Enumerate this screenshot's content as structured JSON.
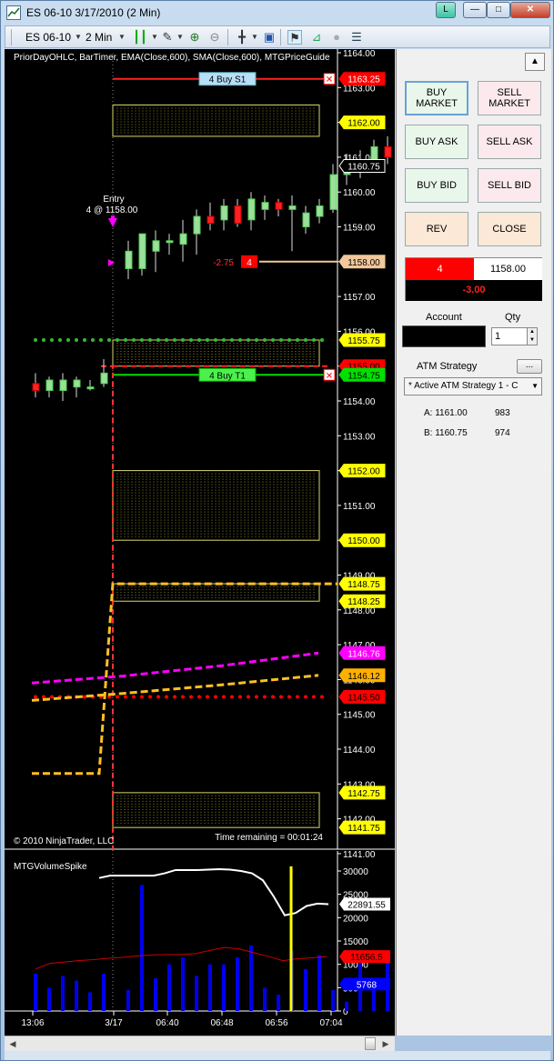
{
  "window": {
    "title": "ES 06-10  3/17/2010 (2 Min)",
    "link_badge": "L",
    "minimize_glyph": "—",
    "maximize_glyph": "□",
    "close_glyph": "✕"
  },
  "toolbar": {
    "instrument": "ES 06-10",
    "interval": "2 Min",
    "icons": [
      "chart-style-icon",
      "draw-tool-icon",
      "zoom-in-icon",
      "zoom-out-icon",
      "crosshair-icon",
      "properties-icon",
      "strategy-icon",
      "indicator-icon",
      "circle-icon",
      "data-box-icon"
    ]
  },
  "chart": {
    "indicators_label": "PriorDayOHLC, BarTimer, EMA(Close,600), SMA(Close,600), MTGPriceGuide",
    "copyright": "© 2010 NinjaTrader, LLC",
    "time_remaining": "Time remaining = 00:01:24",
    "entry_label": "Entry",
    "entry_detail": "4 @ 1158.00",
    "pnl_points": "-2.75",
    "position_qty": "4",
    "buy_s1_label": "4  Buy S1",
    "buy_t1_label": "4  Buy T1",
    "x_labels": [
      "13:06",
      "3/17",
      "06:40",
      "06:48",
      "06:56",
      "07:04"
    ],
    "y_ticks": [
      "1164.00",
      "1163.00",
      "1162.00",
      "1161.00",
      "1160.00",
      "1159.00",
      "1158.00",
      "1157.00",
      "1156.00",
      "1155.00",
      "1154.00",
      "1153.00",
      "1152.00",
      "1151.00",
      "1150.00",
      "1149.00",
      "1148.00",
      "1147.00",
      "1146.00",
      "1145.00",
      "1144.00",
      "1143.00",
      "1142.00",
      "1141.00"
    ],
    "price_tags": [
      {
        "text": "1163.25",
        "color": "#ff0000",
        "fg": "#ffffff"
      },
      {
        "text": "1162.00",
        "color": "#ffff00",
        "fg": "#000000"
      },
      {
        "text": "1160.75",
        "color": "#000000",
        "fg": "#ffffff"
      },
      {
        "text": "1158.00",
        "color": "#f2c79b",
        "fg": "#000000"
      },
      {
        "text": "1155.75",
        "color": "#ffff00",
        "fg": "#000000"
      },
      {
        "text": "1155.00",
        "color": "#ff0000",
        "fg": "#000000"
      },
      {
        "text": "1154.75",
        "color": "#00e000",
        "fg": "#000000"
      },
      {
        "text": "1152.00",
        "color": "#ffff00",
        "fg": "#000000"
      },
      {
        "text": "1150.00",
        "color": "#ffff00",
        "fg": "#000000"
      },
      {
        "text": "1148.75",
        "color": "#ffff00",
        "fg": "#000000"
      },
      {
        "text": "1148.25",
        "color": "#ffff00",
        "fg": "#000000"
      },
      {
        "text": "1146.76",
        "color": "#ff00ff",
        "fg": "#ffffff"
      },
      {
        "text": "1146.12",
        "color": "#ffb000",
        "fg": "#000000"
      },
      {
        "text": "1145.50",
        "color": "#ff0000",
        "fg": "#000000"
      },
      {
        "text": "1142.75",
        "color": "#ffff00",
        "fg": "#000000"
      },
      {
        "text": "1141.75",
        "color": "#ffff00",
        "fg": "#000000"
      }
    ],
    "volume_label": "MTGVolumeSpike",
    "volume_ticks": [
      "30000",
      "25000",
      "20000",
      "15000",
      "10000",
      "5000",
      "0"
    ],
    "volume_tags": [
      {
        "text": "22891.55",
        "color": "#ffffff",
        "fg": "#000000"
      },
      {
        "text": "11656.5",
        "color": "#ff0000",
        "fg": "#000000"
      },
      {
        "text": "5768",
        "color": "#0000ff",
        "fg": "#ffffff"
      }
    ]
  },
  "chart_data": {
    "type": "candlestick",
    "title": "ES 06-10 3/17/2010 (2 Min)",
    "ylim": [
      1141,
      1164
    ],
    "price_axis_ticks": [
      1141,
      1142,
      1143,
      1144,
      1145,
      1146,
      1147,
      1148,
      1149,
      1150,
      1151,
      1152,
      1153,
      1154,
      1155,
      1156,
      1157,
      1158,
      1159,
      1160,
      1161,
      1162,
      1163,
      1164
    ],
    "x_labels": [
      "13:06",
      "3/17",
      "06:40",
      "06:48",
      "06:56",
      "07:04"
    ],
    "candles": [
      {
        "o": 1154.5,
        "h": 1154.8,
        "l": 1154.1,
        "c": 1154.3
      },
      {
        "o": 1154.3,
        "h": 1154.7,
        "l": 1154.1,
        "c": 1154.6
      },
      {
        "o": 1154.3,
        "h": 1154.8,
        "l": 1154.0,
        "c": 1154.6
      },
      {
        "o": 1154.4,
        "h": 1154.7,
        "l": 1154.1,
        "c": 1154.6
      },
      {
        "o": 1154.4,
        "h": 1154.6,
        "l": 1154.3,
        "c": 1154.4
      },
      {
        "o": 1154.5,
        "h": 1155.2,
        "l": 1154.4,
        "c": 1154.8
      },
      {
        "o": 1157.8,
        "h": 1158.6,
        "l": 1157.5,
        "c": 1158.3
      },
      {
        "o": 1157.8,
        "h": 1158.8,
        "l": 1157.6,
        "c": 1158.8
      },
      {
        "o": 1158.3,
        "h": 1158.9,
        "l": 1157.7,
        "c": 1158.6
      },
      {
        "o": 1158.6,
        "h": 1158.8,
        "l": 1158.2,
        "c": 1158.6
      },
      {
        "o": 1158.5,
        "h": 1159.2,
        "l": 1158.0,
        "c": 1158.8
      },
      {
        "o": 1158.8,
        "h": 1159.5,
        "l": 1158.2,
        "c": 1159.3
      },
      {
        "o": 1159.3,
        "h": 1159.7,
        "l": 1158.9,
        "c": 1159.1
      },
      {
        "o": 1159.2,
        "h": 1159.8,
        "l": 1158.9,
        "c": 1159.6
      },
      {
        "o": 1159.6,
        "h": 1159.8,
        "l": 1159.0,
        "c": 1159.1
      },
      {
        "o": 1159.2,
        "h": 1160.0,
        "l": 1158.9,
        "c": 1159.8
      },
      {
        "o": 1159.5,
        "h": 1159.9,
        "l": 1159.2,
        "c": 1159.7
      },
      {
        "o": 1159.7,
        "h": 1159.8,
        "l": 1159.3,
        "c": 1159.5
      },
      {
        "o": 1159.5,
        "h": 1159.9,
        "l": 1158.3,
        "c": 1159.6
      },
      {
        "o": 1159.0,
        "h": 1159.6,
        "l": 1158.8,
        "c": 1159.4
      },
      {
        "o": 1159.3,
        "h": 1159.8,
        "l": 1159.1,
        "c": 1159.6
      },
      {
        "o": 1159.5,
        "h": 1160.8,
        "l": 1159.4,
        "c": 1160.5
      },
      {
        "o": 1160.5,
        "h": 1161.1,
        "l": 1160.2,
        "c": 1160.8
      },
      {
        "o": 1160.8,
        "h": 1161.2,
        "l": 1160.4,
        "c": 1160.9
      },
      {
        "o": 1160.8,
        "h": 1161.5,
        "l": 1160.6,
        "c": 1161.3
      },
      {
        "o": 1161.3,
        "h": 1161.6,
        "l": 1160.8,
        "c": 1161.0
      },
      {
        "o": 1161.3,
        "h": 1161.4,
        "l": 1160.6,
        "c": 1160.8
      }
    ],
    "levels": [
      {
        "name": "Buy S1",
        "value": 1163.25
      },
      {
        "name": "Position entry",
        "value": 1158.0
      },
      {
        "name": "Buy T1",
        "value": 1154.75
      },
      {
        "name": "Stop",
        "value": 1155.0
      },
      {
        "name": "Prior day close",
        "value": 1145.5
      }
    ],
    "volume_ylim": [
      0,
      32000
    ],
    "volume_ticks": [
      0,
      5000,
      10000,
      15000,
      20000,
      25000,
      30000
    ],
    "volume": [
      8000,
      5000,
      7500,
      6500,
      4000,
      8000,
      4500,
      27000,
      7000,
      10000,
      11500,
      7500,
      10000,
      10000,
      11500,
      14000,
      5000,
      3500,
      13000,
      9000,
      12000,
      4500,
      2000,
      13000,
      5500,
      12000,
      6000
    ],
    "volume_spike_line": [
      28500,
      29000,
      29000,
      29000,
      29000,
      29000,
      29500,
      30200,
      30200,
      30200,
      30300,
      30400,
      30300,
      30000,
      29500,
      28000,
      24500,
      20500,
      21000,
      22500,
      23000,
      22900
    ],
    "volume_ma_line": [
      9000,
      10200,
      10500,
      10800,
      11000,
      11300,
      11500,
      11800,
      12000,
      12100,
      12100,
      12300,
      13000,
      13600,
      13300,
      12500,
      11700,
      10800,
      11200,
      11400,
      11656.5
    ]
  },
  "order_panel": {
    "buy_market": "BUY\nMARKET",
    "sell_market": "SELL\nMARKET",
    "buy_ask": "BUY ASK",
    "sell_ask": "SELL ASK",
    "buy_bid": "BUY BID",
    "sell_bid": "SELL BID",
    "rev": "REV",
    "close": "CLOSE",
    "position_qty": "4",
    "position_price": "1158.00",
    "pnl": "-3.00",
    "account_label": "Account",
    "qty_label": "Qty",
    "qty_value": "1",
    "atm_label": "ATM Strategy",
    "atm_button": "...",
    "atm_selected": "* Active ATM Strategy 1 - C",
    "ask_label": "A: 1161.00",
    "ask_size": "983",
    "bid_label": "B: 1160.75",
    "bid_size": "974",
    "colors": {
      "buy": "#e8f7ea",
      "sell": "#fbe9ee",
      "rev": "#fbe8d6",
      "long": "#ff0000",
      "pnl_bg": "#000000",
      "pnl_fg": "#ff2020"
    }
  }
}
